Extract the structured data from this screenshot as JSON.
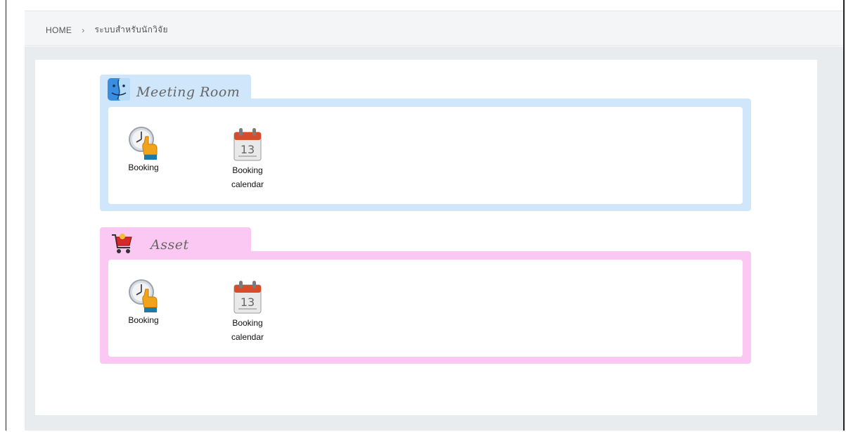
{
  "breadcrumb": {
    "home": "HOME",
    "separator": "›",
    "current": "ระบบสำหรับนักวิจัย"
  },
  "panels": [
    {
      "title": "Meeting Room",
      "icon": "finder-face-icon",
      "color": "#cfe6fb",
      "items": [
        {
          "label": "Booking",
          "icon": "clock-hand-icon"
        },
        {
          "label_line1": "Booking",
          "label_line2": "calendar",
          "icon": "calendar-icon",
          "day": "13"
        }
      ]
    },
    {
      "title": "Asset",
      "icon": "shopping-cart-icon",
      "color": "#fac8f2",
      "items": [
        {
          "label": "Booking",
          "icon": "clock-hand-icon"
        },
        {
          "label_line1": "Booking",
          "label_line2": "calendar",
          "icon": "calendar-icon",
          "day": "13"
        }
      ]
    }
  ]
}
